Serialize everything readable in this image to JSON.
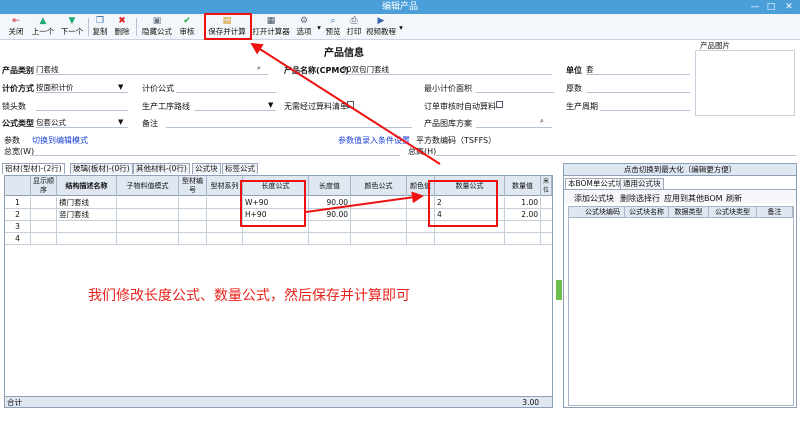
{
  "window": {
    "title": "编辑产品",
    "minimize": "—",
    "maximize": "□",
    "close": "✕"
  },
  "toolbar": {
    "close": "关闭",
    "prev": "上一个",
    "next": "下一个",
    "copy": "复制",
    "delete": "删除",
    "hide_formula": "隐藏公式",
    "review": "审核",
    "save_calc": "保存并计算",
    "open_calc": "打开计算器",
    "options": "选项",
    "preview": "预览",
    "print": "打印",
    "video": "视频教程"
  },
  "form": {
    "title": "产品信息",
    "category_label": "产品类别",
    "category_value": "门套线",
    "name_label": "产品名称(CPMC)",
    "name_value": "90双包门套线",
    "unit_label": "单位",
    "unit_value": "套",
    "image_label": "产品图片",
    "pricing_label": "计价方式",
    "pricing_value": "按面积计价",
    "pricing_formula_label": "计价公式",
    "min_area_label": "最小计价面积",
    "thickness_label": "厚数",
    "lock_label": "锁头数",
    "process_label": "生产工序路线",
    "no_calc_label": "无需经过算料清单",
    "auto_calc_label": "订单审核时自动算料",
    "cycle_label": "生产周期",
    "formula_type_label": "公式类型",
    "formula_type_value": "包套公式",
    "remark_label": "备注",
    "gallery_label": "产品图库方案",
    "param_label": "参数",
    "edit_mode_link": "切换到编辑模式",
    "param_input_link": "参数值录入条件设置",
    "flat_code_label": "平方数编码（TSFFS）",
    "total_width_label": "总宽(W)",
    "total_height_label": "总高(H)"
  },
  "tabs": [
    "铝材(型材)-(2行)",
    "玻璃(板材)-(0行)",
    "其他材料-(0行)",
    "公式块",
    "标签公式"
  ],
  "grid": {
    "headers": [
      "显示顺序",
      "结构描述名称",
      "子物料值模式",
      "型材编号",
      "型材系列",
      "长度公式",
      "长度值",
      "颜色公式",
      "颜色值",
      "数量公式",
      "数量值",
      "米位"
    ],
    "rows": [
      {
        "n": "1",
        "name": "横门套线",
        "len_formula": "W+90",
        "len_val": "90.00",
        "qty_formula": "2",
        "qty_val": "1.00"
      },
      {
        "n": "2",
        "name": "竖门套线",
        "len_formula": "H+90",
        "len_val": "90.00",
        "qty_formula": "4",
        "qty_val": "2.00"
      },
      {
        "n": "3",
        "name": "",
        "len_formula": "",
        "len_val": "",
        "qty_formula": "",
        "qty_val": ""
      },
      {
        "n": "4",
        "name": "",
        "len_formula": "",
        "len_val": "",
        "qty_formula": "",
        "qty_val": ""
      }
    ],
    "footer_label": "合计",
    "footer_total": "3.00"
  },
  "right_panel": {
    "header": "点击切换到最大化（编辑更方便）",
    "tabs": [
      "本BOM单公式块",
      "通用公式块"
    ],
    "actions": [
      "添加公式块",
      "删除选择行",
      "应用到其他BOM",
      "刷新"
    ],
    "headers": [
      "公式块编码",
      "公式块名称",
      "数据类型",
      "公式块类型",
      "备注"
    ]
  },
  "annotation": "我们修改长度公式、数量公式，然后保存并计算即可"
}
